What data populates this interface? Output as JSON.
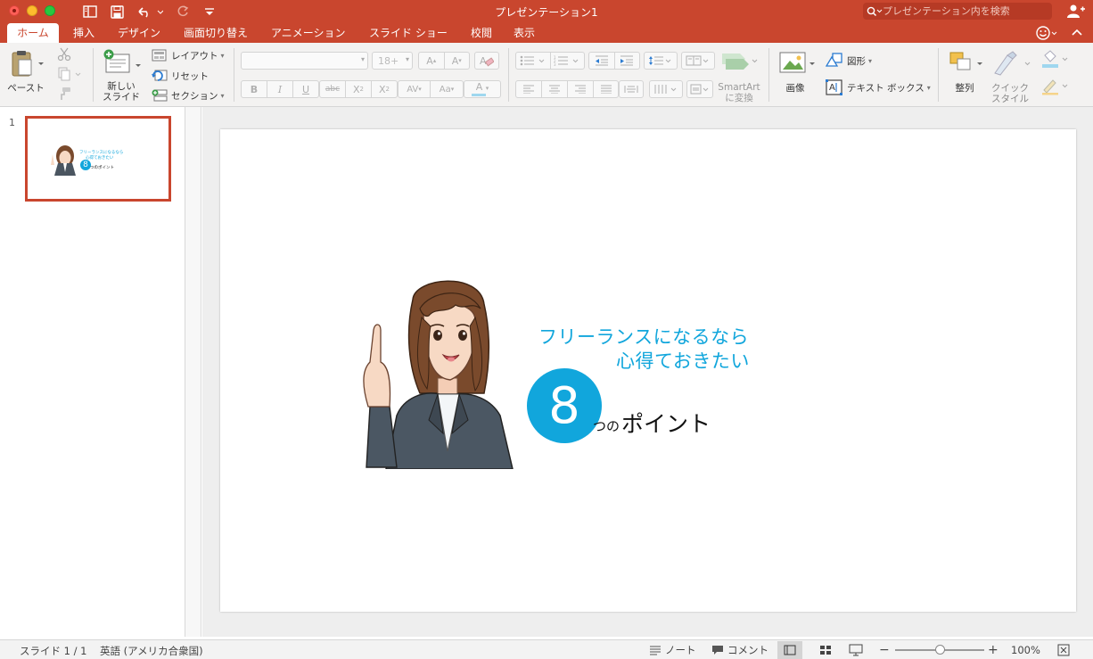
{
  "window": {
    "title": "プレゼンテーション1",
    "search_placeholder": "プレゼンテーション内を検索"
  },
  "tabs": [
    {
      "label": "ホーム",
      "active": true
    },
    {
      "label": "挿入"
    },
    {
      "label": "デザイン"
    },
    {
      "label": "画面切り替え"
    },
    {
      "label": "アニメーション"
    },
    {
      "label": "スライド ショー"
    },
    {
      "label": "校閲"
    },
    {
      "label": "表示"
    }
  ],
  "ribbon": {
    "paste": "ペースト",
    "new_slide_1": "新しい",
    "new_slide_2": "スライド",
    "layout": "レイアウト",
    "reset": "リセット",
    "section": "セクション",
    "font_size": "18+",
    "smartart_1": "SmartArt",
    "smartart_2": "に変換",
    "picture": "画像",
    "shapes": "図形",
    "textbox": "テキスト ボックス",
    "arrange": "整列",
    "quick_styles_1": "クイック",
    "quick_styles_2": "スタイル"
  },
  "slides_pane": {
    "slide_number": "1",
    "thumb_title_1": "フリーランスになるなら",
    "thumb_title_2": "心得ておきたい",
    "thumb_number": "8",
    "thumb_suffix": "つのポイント"
  },
  "slide": {
    "title_line1": "フリーランスになるなら",
    "title_line2": "心得ておきたい",
    "number": "8",
    "suffix_small": "つの",
    "suffix_big": "ポイント"
  },
  "status": {
    "slide_position": "スライド 1 / 1",
    "language": "英語 (アメリカ合衆国)",
    "notes": "ノート",
    "comments": "コメント",
    "zoom": "100%",
    "zoom_fraction": 0.5
  },
  "colors": {
    "accent": "#c9462e",
    "slide_accent": "#11a6dc"
  }
}
